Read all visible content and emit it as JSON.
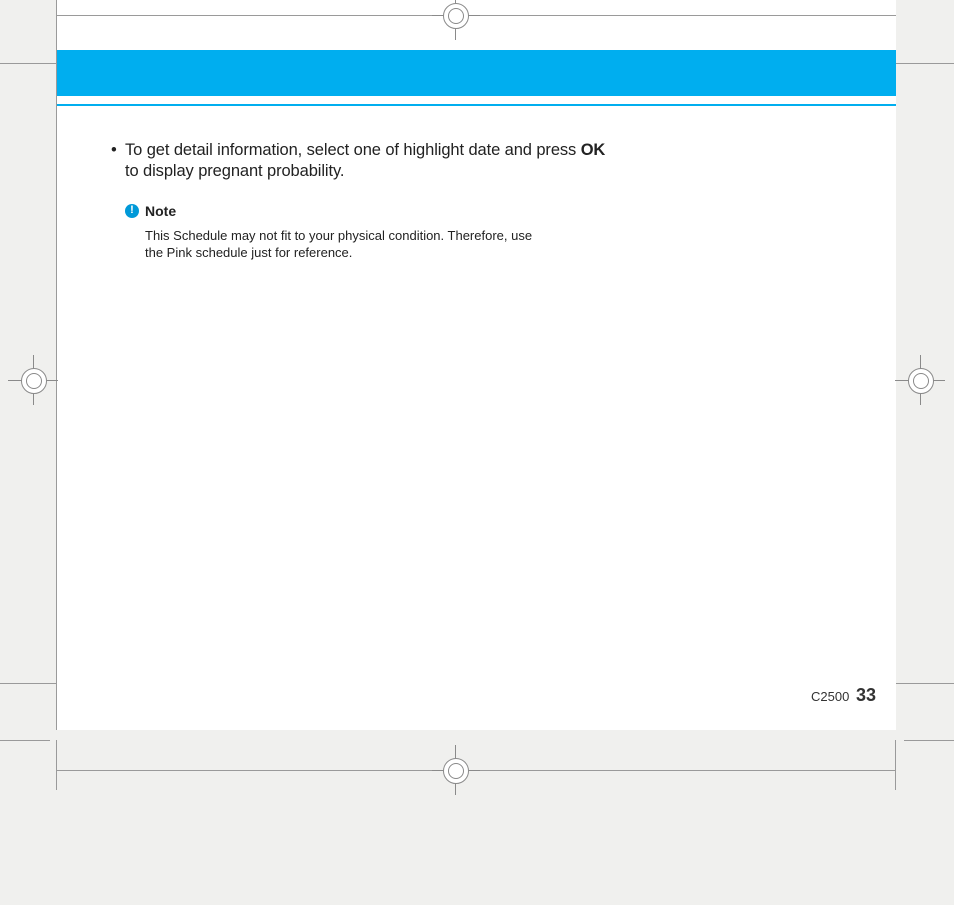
{
  "body": {
    "bullet_prefix": "To get detail information, select one of highlight date and press ",
    "bullet_bold": "OK",
    "bullet_suffix": " to display pregnant probability."
  },
  "note": {
    "icon_glyph": "!",
    "label": "Note",
    "text": "This Schedule may not fit to your physical condition. Therefore, use the Pink schedule just for reference."
  },
  "footer": {
    "model": "C2500",
    "page": "33"
  }
}
